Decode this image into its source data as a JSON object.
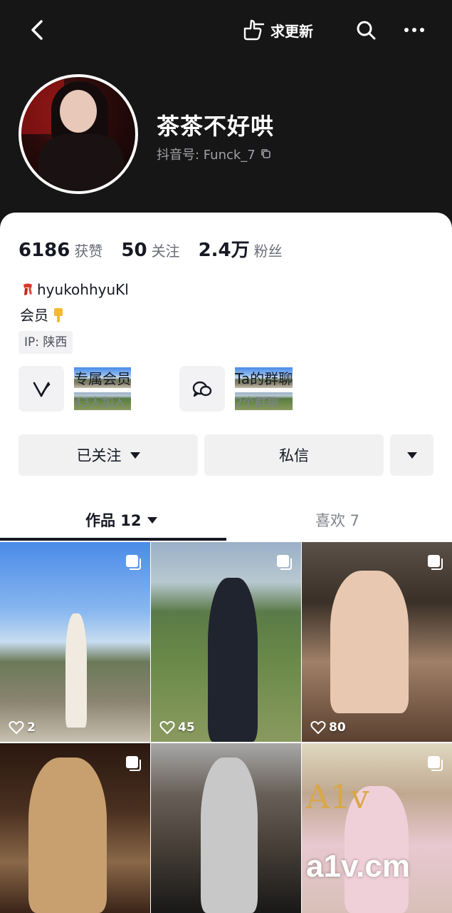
{
  "header": {
    "request_update_label": "求更新"
  },
  "profile": {
    "name": "茶茶不好哄",
    "douyin_id": "抖音号: Funck_7"
  },
  "stats": [
    {
      "value": "6186",
      "label": "获赞"
    },
    {
      "value": "50",
      "label": "关注"
    },
    {
      "value": "2.4万",
      "label": "粉丝"
    }
  ],
  "bio": {
    "line1": "hyukohhyuKl",
    "line2": "会员",
    "ip": "IP: 陕西"
  },
  "features": [
    {
      "title": "专属会员",
      "subtitle": "43人加入",
      "icon": "v-member-icon"
    },
    {
      "title": "Ta的群聊",
      "subtitle": "2个群聊",
      "icon": "chat-group-icon"
    }
  ],
  "actions": {
    "follow_label": "已关注",
    "message_label": "私信"
  },
  "tabs": {
    "works_label": "作品 12",
    "likes_label": "喜欢 7"
  },
  "posts": [
    {
      "likes": "2"
    },
    {
      "likes": "45"
    },
    {
      "likes": "80"
    }
  ],
  "watermark": {
    "logo_text": "A1v",
    "site_text": "a1v.cm"
  },
  "colors": {
    "header_bg": "#161616",
    "button_bg": "#f1f1f2",
    "text_primary": "#161823",
    "text_secondary": "#80838c"
  }
}
